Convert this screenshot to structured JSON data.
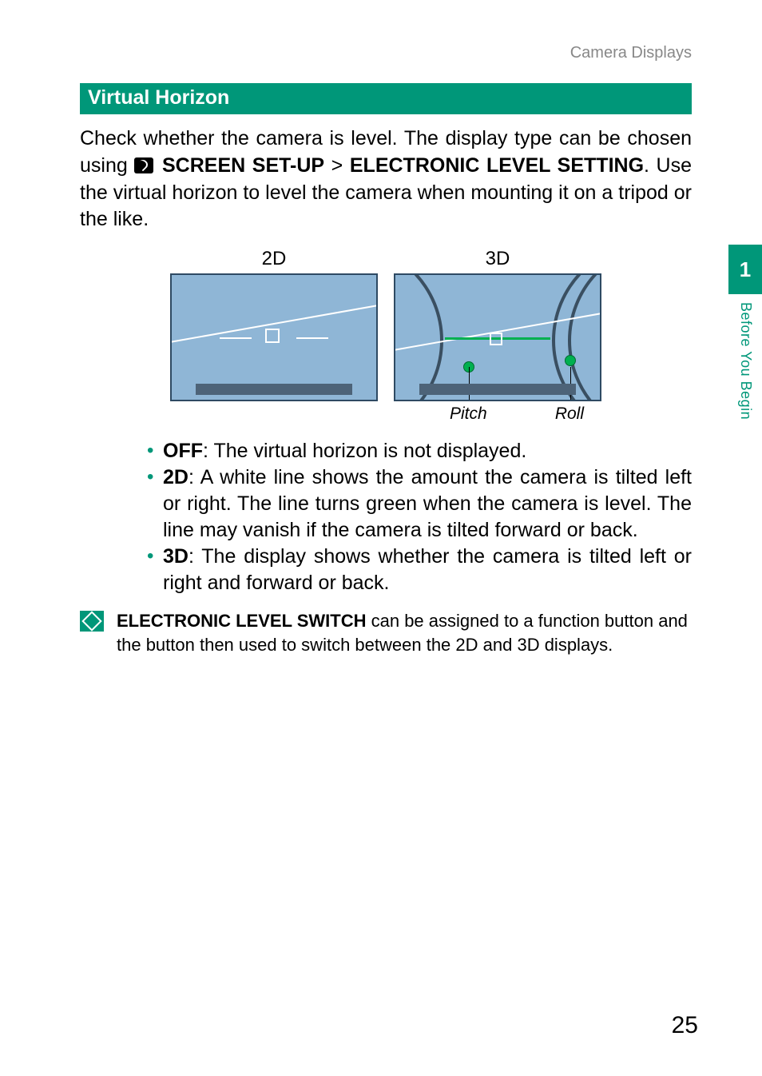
{
  "breadcrumb": "Camera Displays",
  "section_title": "Virtual Horizon",
  "intro_before": "Check whether the camera is level. The display type can be chosen using ",
  "intro_menu1": "SCREEN SET-UP",
  "intro_gt": " > ",
  "intro_menu2": "ELECTRONIC LEVEL SETTING",
  "intro_after": ". Use the virtual horizon to level the camera when mounting it on a tripod or the like.",
  "diagram": {
    "left_label": "2D",
    "right_label": "3D",
    "pitch": "Pitch",
    "roll": "Roll"
  },
  "bullets": [
    {
      "term": "OFF",
      "text": ": The virtual horizon is not displayed."
    },
    {
      "term": "2D",
      "text": ": A white line shows the amount the camera is tilted left or right. The line turns green when the camera is level. The line may vanish if the camera is tilted forward or back."
    },
    {
      "term": "3D",
      "text": ": The display shows whether the camera is tilted left or right and forward or back."
    }
  ],
  "note_bold": "ELECTRONIC LEVEL SWITCH",
  "note_rest": " can be assigned to a function button and the button then used to switch between the 2D and 3D displays.",
  "side": {
    "chapter": "1",
    "label": "Before You Begin"
  },
  "page_number": "25"
}
